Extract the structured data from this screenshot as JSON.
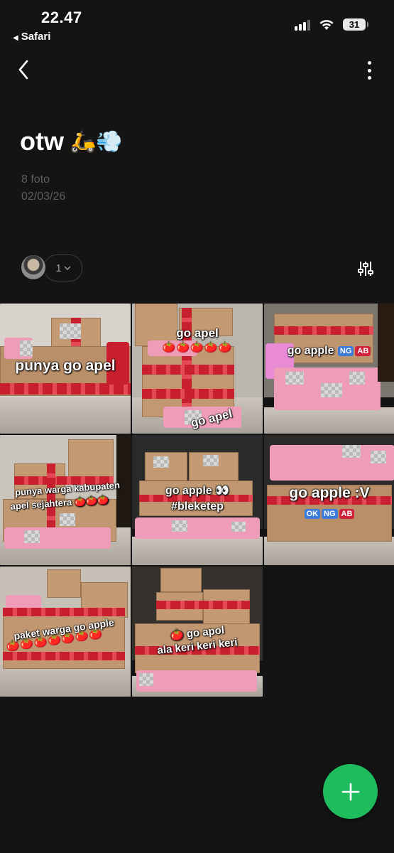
{
  "status_bar": {
    "time": "22.47",
    "back_app": "Safari",
    "battery": "31"
  },
  "album": {
    "title": "otw",
    "title_emoji": "🛵💨",
    "photo_count": "8 foto",
    "date": "02/03/26",
    "member_count": "1"
  },
  "photos": [
    {
      "caption": "punya go apel",
      "apples": ""
    },
    {
      "caption": "go apel",
      "apples": "🍅🍅🍅🍅🍅",
      "caption2": "go apel"
    },
    {
      "caption": "go apple",
      "tags": [
        "NG",
        "AB"
      ]
    },
    {
      "caption": "punya warga kabupaten",
      "caption2": "apel sejahtera",
      "apples": "🍅🍅🍅"
    },
    {
      "caption": "go apple 👀",
      "caption2": "#bleketep"
    },
    {
      "caption": "go apple :V",
      "tags": [
        "OK",
        "NG",
        "AB"
      ]
    },
    {
      "caption": "paket warga go apple",
      "apples": "🍅🍅🍅🍅🍅🍅🍅"
    },
    {
      "caption": "go apol",
      "caption2": "ala keri keri keri",
      "apples": "🍅"
    }
  ],
  "colors": {
    "background": "#141414",
    "fab": "#1ebc5d",
    "muted_text": "#5f5f5f"
  }
}
